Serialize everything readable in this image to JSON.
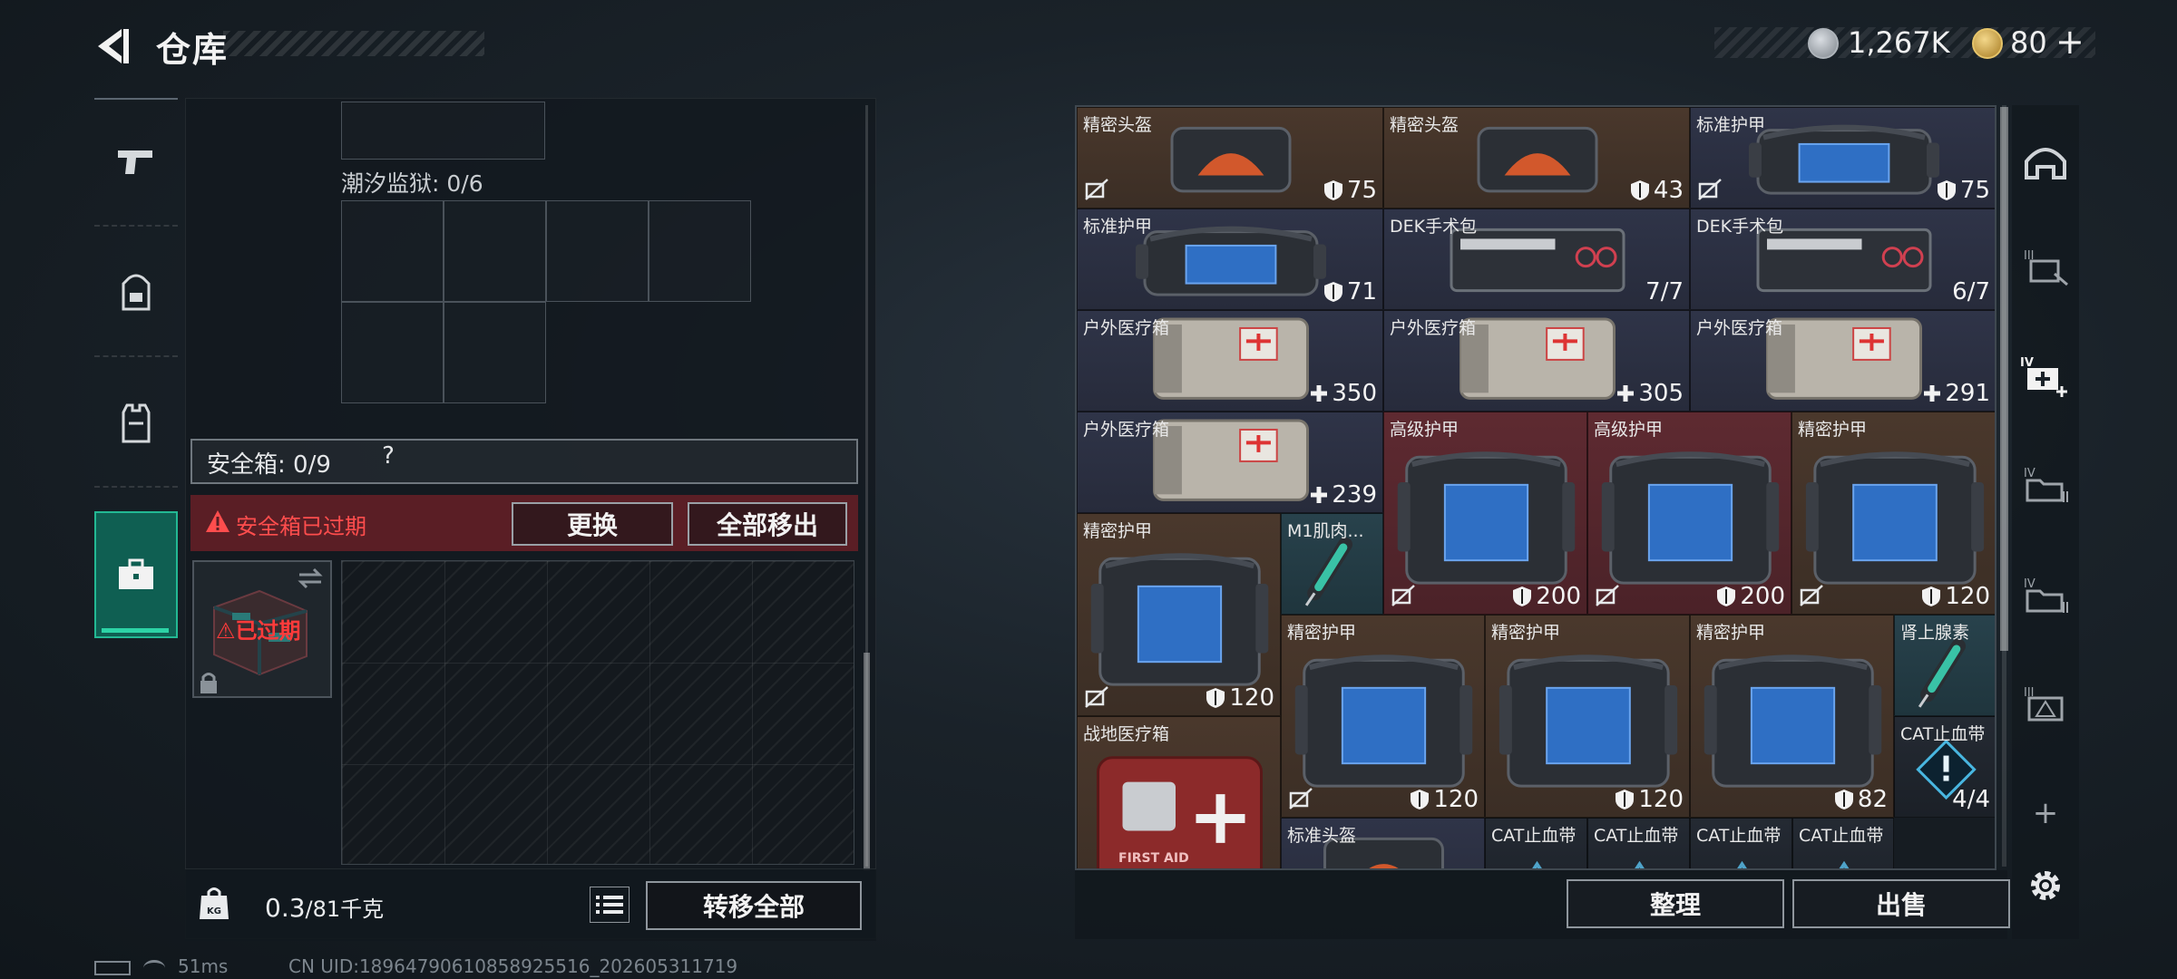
{
  "header": {
    "title": "仓库",
    "currency1_value": "1,267K",
    "currency2_value": "80",
    "currency2_plus": "+"
  },
  "left_nav": {
    "items": [
      {
        "name": "pistol-icon"
      },
      {
        "name": "backpack-icon"
      },
      {
        "name": "vest-icon"
      },
      {
        "name": "briefcase-icon",
        "active": true
      }
    ]
  },
  "container": {
    "capacity_label": "潮汐监狱: 0/6",
    "safe_label": "安全箱: 0/9",
    "safe_help": "?",
    "alert_text": "安全箱已过期",
    "replace_button": "更换",
    "remove_all_button": "全部移出",
    "case_status": "已过期",
    "weight_value": "0.3",
    "weight_capacity": "/81千克",
    "transfer_all_button": "转移全部"
  },
  "status_bar": {
    "ping": "51ms",
    "uid": "CN UID:18964790610858925516_202605311719"
  },
  "inventory": {
    "tiles": [
      {
        "name": "精密头盔",
        "value": "75",
        "icon": "shield-icon",
        "bg": "brown",
        "kind": "helmet",
        "lock": true
      },
      {
        "name": "精密头盔",
        "value": "43",
        "icon": "shield-icon",
        "bg": "brown",
        "kind": "helmet",
        "lock": false
      },
      {
        "name": "标准护甲",
        "value": "75",
        "icon": "shield-icon",
        "bg": "blue",
        "kind": "armor",
        "lock": true
      },
      {
        "name": "标准护甲",
        "value": "71",
        "icon": "shield-icon",
        "bg": "blue",
        "kind": "armor",
        "lock": false
      },
      {
        "name": "DEK手术包",
        "value": "7/7",
        "icon": "",
        "bg": "blue",
        "kind": "surgery",
        "lock": false
      },
      {
        "name": "DEK手术包",
        "value": "6/7",
        "icon": "",
        "bg": "blue",
        "kind": "surgery",
        "lock": false
      },
      {
        "name": "户外医疗箱",
        "value": "350",
        "icon": "plus-icon",
        "bg": "blue",
        "kind": "medbag",
        "lock": false
      },
      {
        "name": "户外医疗箱",
        "value": "305",
        "icon": "plus-icon",
        "bg": "blue",
        "kind": "medbag",
        "lock": false
      },
      {
        "name": "户外医疗箱",
        "value": "291",
        "icon": "plus-icon",
        "bg": "blue",
        "kind": "medbag",
        "lock": false
      },
      {
        "name": "户外医疗箱",
        "value": "239",
        "icon": "plus-icon",
        "bg": "blue",
        "kind": "medbag",
        "lock": false
      },
      {
        "name": "高级护甲",
        "value": "200",
        "icon": "shield-icon",
        "bg": "red",
        "kind": "armor",
        "lock": true
      },
      {
        "name": "高级护甲",
        "value": "200",
        "icon": "shield-icon",
        "bg": "red",
        "kind": "armor",
        "lock": true
      },
      {
        "name": "精密护甲",
        "value": "120",
        "icon": "shield-icon",
        "bg": "brown",
        "kind": "armor",
        "lock": true
      },
      {
        "name": "精密护甲",
        "value": "120",
        "icon": "shield-icon",
        "bg": "brown",
        "kind": "armor",
        "lock": true
      },
      {
        "name": "M1肌肉...",
        "value": "",
        "icon": "",
        "bg": "teal",
        "kind": "syringe",
        "lock": false
      },
      {
        "name": "精密护甲",
        "value": "120",
        "icon": "shield-icon",
        "bg": "brown",
        "kind": "armor",
        "lock": true
      },
      {
        "name": "精密护甲",
        "value": "120",
        "icon": "shield-icon",
        "bg": "brown",
        "kind": "armor",
        "lock": false
      },
      {
        "name": "精密护甲",
        "value": "82",
        "icon": "shield-icon",
        "bg": "brown",
        "kind": "armor",
        "lock": false
      },
      {
        "name": "肾上腺素",
        "value": "",
        "icon": "",
        "bg": "teal",
        "kind": "syringe",
        "lock": false
      },
      {
        "name": "CAT止血带",
        "value": "4/4",
        "icon": "",
        "bg": "dark",
        "kind": "alert",
        "lock": false
      },
      {
        "name": "战地医疗箱",
        "value": "",
        "icon": "",
        "bg": "brown",
        "kind": "firstaid",
        "lock": false
      },
      {
        "name": "标准头盔",
        "value": "",
        "icon": "",
        "bg": "blue",
        "kind": "helmet",
        "lock": false
      },
      {
        "name": "CAT止血带",
        "value": "",
        "icon": "",
        "bg": "dark",
        "kind": "cat",
        "lock": false
      },
      {
        "name": "CAT止血带",
        "value": "",
        "icon": "",
        "bg": "dark",
        "kind": "cat",
        "lock": false
      },
      {
        "name": "CAT止血带",
        "value": "",
        "icon": "",
        "bg": "dark",
        "kind": "cat",
        "lock": false
      },
      {
        "name": "CAT止血带",
        "value": "",
        "icon": "",
        "bg": "dark",
        "kind": "cat",
        "lock": false
      }
    ],
    "first_aid_text": "FIRST AID",
    "sort_button": "整理",
    "sell_button": "出售"
  },
  "right_nav": {
    "items": [
      {
        "name": "helmet-icon"
      },
      {
        "name": "tier-3-armor-icon",
        "tier": "III"
      },
      {
        "name": "tier-4-medical-icon",
        "tier": "IV"
      },
      {
        "name": "tier-4-folder-icon",
        "tier": "IV"
      },
      {
        "name": "tier-4-box-icon",
        "tier": "IV"
      },
      {
        "name": "tier-3-warning-icon",
        "tier": "III"
      },
      {
        "name": "add-icon"
      },
      {
        "name": "settings-icon"
      }
    ],
    "add_label": "+"
  }
}
